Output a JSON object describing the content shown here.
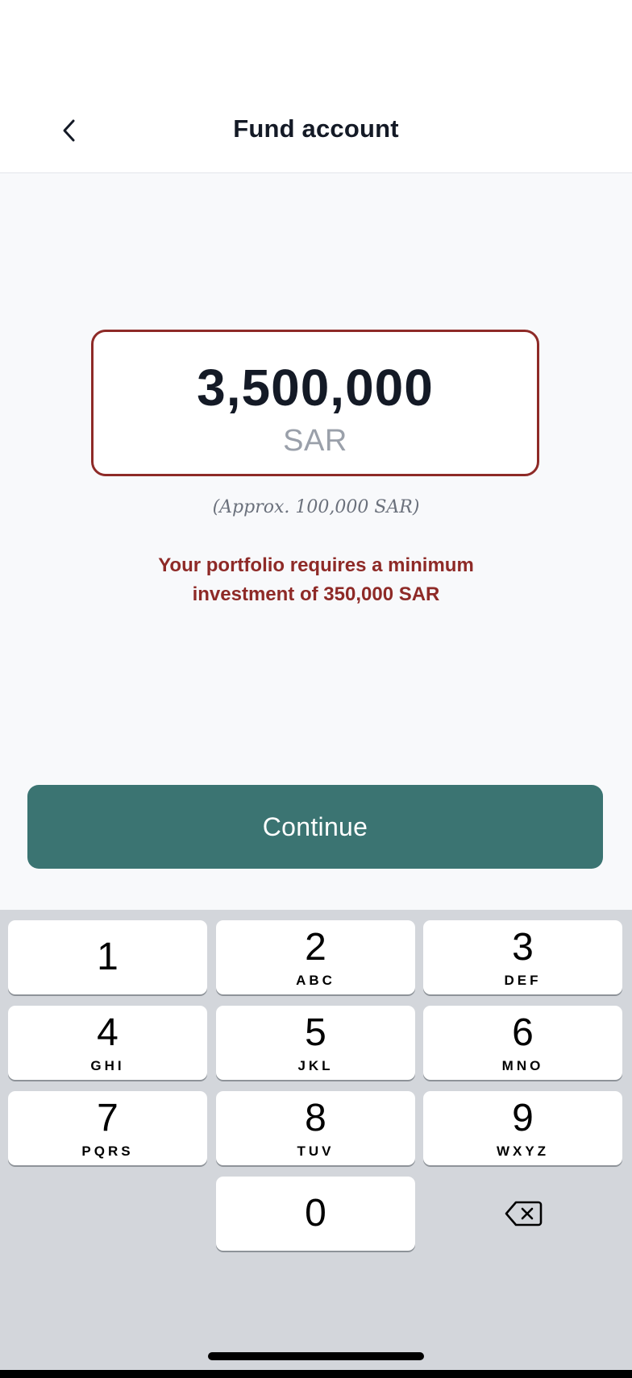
{
  "header": {
    "title": "Fund account",
    "back_icon": "chevron-left-icon"
  },
  "amount": {
    "value": "3,500,000",
    "currency": "SAR",
    "approx": "(Approx. 100,000 SAR)",
    "border_color": "#8e2a27"
  },
  "error": {
    "message": "Your portfolio requires a minimum investment of 350,000 SAR",
    "color": "#8e2a27"
  },
  "continue": {
    "label": "Continue",
    "color": "#3b7472"
  },
  "keypad": {
    "keys": [
      {
        "digit": "1",
        "letters": ""
      },
      {
        "digit": "2",
        "letters": "ABC"
      },
      {
        "digit": "3",
        "letters": "DEF"
      },
      {
        "digit": "4",
        "letters": "GHI"
      },
      {
        "digit": "5",
        "letters": "JKL"
      },
      {
        "digit": "6",
        "letters": "MNO"
      },
      {
        "digit": "7",
        "letters": "PQRS"
      },
      {
        "digit": "8",
        "letters": "TUV"
      },
      {
        "digit": "9",
        "letters": "WXYZ"
      },
      {
        "digit": "0",
        "letters": ""
      }
    ],
    "delete_icon": "backspace-icon"
  }
}
